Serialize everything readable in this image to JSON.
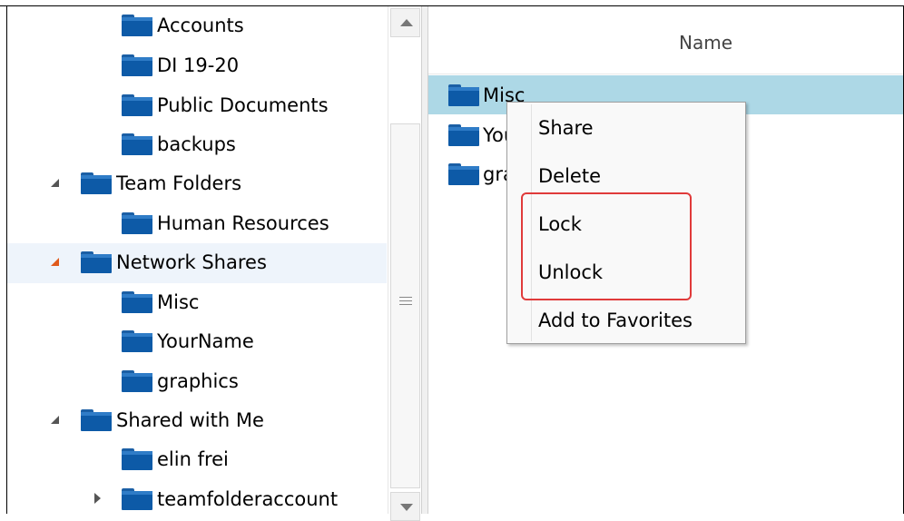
{
  "tree": {
    "items": [
      {
        "label": "Accounts",
        "level": 2,
        "expander": "none"
      },
      {
        "label": "DI 19-20",
        "level": 2,
        "expander": "none"
      },
      {
        "label": "Public Documents",
        "level": 2,
        "expander": "none"
      },
      {
        "label": "backups",
        "level": 2,
        "expander": "none"
      },
      {
        "label": "Team Folders",
        "level": 1,
        "expander": "expanded"
      },
      {
        "label": "Human Resources",
        "level": 2,
        "expander": "none"
      },
      {
        "label": "Network Shares",
        "level": 1,
        "expander": "expanded",
        "selected": true
      },
      {
        "label": "Misc",
        "level": 2,
        "expander": "none"
      },
      {
        "label": "YourName",
        "level": 2,
        "expander": "none"
      },
      {
        "label": "graphics",
        "level": 2,
        "expander": "none"
      },
      {
        "label": "Shared with Me",
        "level": 1,
        "expander": "expanded"
      },
      {
        "label": "elin frei",
        "level": 2,
        "expander": "none"
      },
      {
        "label": "teamfolderaccount",
        "level": 2,
        "expander": "collapsed"
      }
    ]
  },
  "list": {
    "column_header": "Name",
    "rows": [
      {
        "label": "Misc",
        "selected": true
      },
      {
        "label": "YourName",
        "selected": false
      },
      {
        "label": "graphics",
        "selected": false
      }
    ]
  },
  "context_menu": {
    "items": [
      "Share",
      "Delete",
      "Lock",
      "Unlock",
      "Add to Favorites"
    ],
    "highlighted": [
      "Lock",
      "Unlock"
    ]
  },
  "icons": {
    "folder": "folder-icon",
    "scroll_up": "chevron-up-icon",
    "scroll_down": "chevron-down-icon",
    "grip": "grip-icon"
  },
  "colors": {
    "folder": "#0d5aa7",
    "selection_list": "#add8e6",
    "selection_tree": "#eef4fb",
    "active_expander": "#e05a1c",
    "highlight_box": "#e03a3a"
  }
}
